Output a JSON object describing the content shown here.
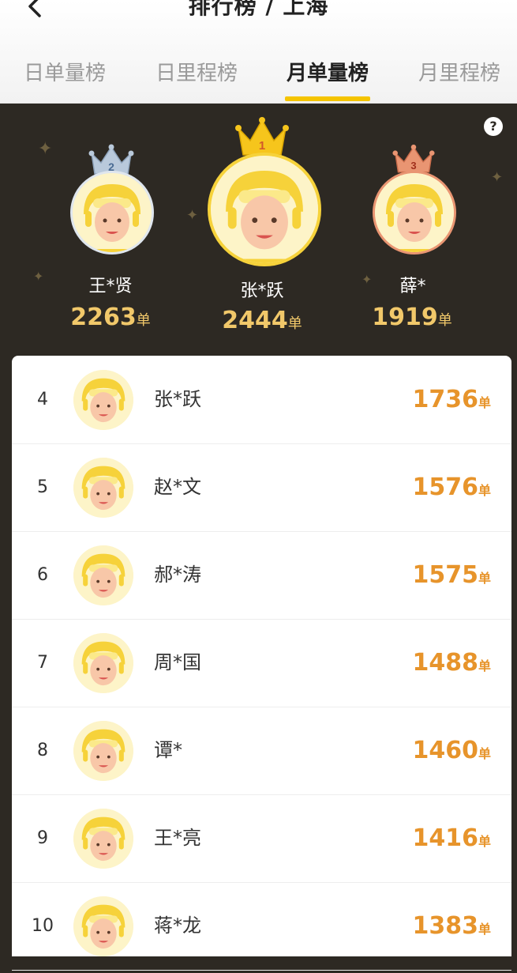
{
  "header": {
    "title": "排行榜 / 上海"
  },
  "tabs": [
    {
      "label": "日单量榜",
      "active": false
    },
    {
      "label": "日里程榜",
      "active": false
    },
    {
      "label": "月单量榜",
      "active": true
    },
    {
      "label": "月里程榜",
      "active": false
    }
  ],
  "help": {
    "label": "?"
  },
  "top3": [
    {
      "rank": "2",
      "name": "王*贤",
      "count": "2263",
      "unit": "单"
    },
    {
      "rank": "1",
      "name": "张*跃",
      "count": "2444",
      "unit": "单"
    },
    {
      "rank": "3",
      "name": "薛*",
      "count": "1919",
      "unit": "单"
    }
  ],
  "rows": [
    {
      "rank": "4",
      "name": "张*跃",
      "count": "1736",
      "unit": "单"
    },
    {
      "rank": "5",
      "name": "赵*文",
      "count": "1576",
      "unit": "单"
    },
    {
      "rank": "6",
      "name": "郝*涛",
      "count": "1575",
      "unit": "单"
    },
    {
      "rank": "7",
      "name": "周*国",
      "count": "1488",
      "unit": "单"
    },
    {
      "rank": "8",
      "name": "谭*",
      "count": "1460",
      "unit": "单"
    },
    {
      "rank": "9",
      "name": "王*亮",
      "count": "1416",
      "unit": "单"
    },
    {
      "rank": "10",
      "name": "蒋*龙",
      "count": "1383",
      "unit": "单"
    }
  ],
  "colors": {
    "accent": "#f5c400",
    "count": "#e7942b",
    "podium_bg": "#2d2923",
    "gold_count": "#f1c86a"
  }
}
